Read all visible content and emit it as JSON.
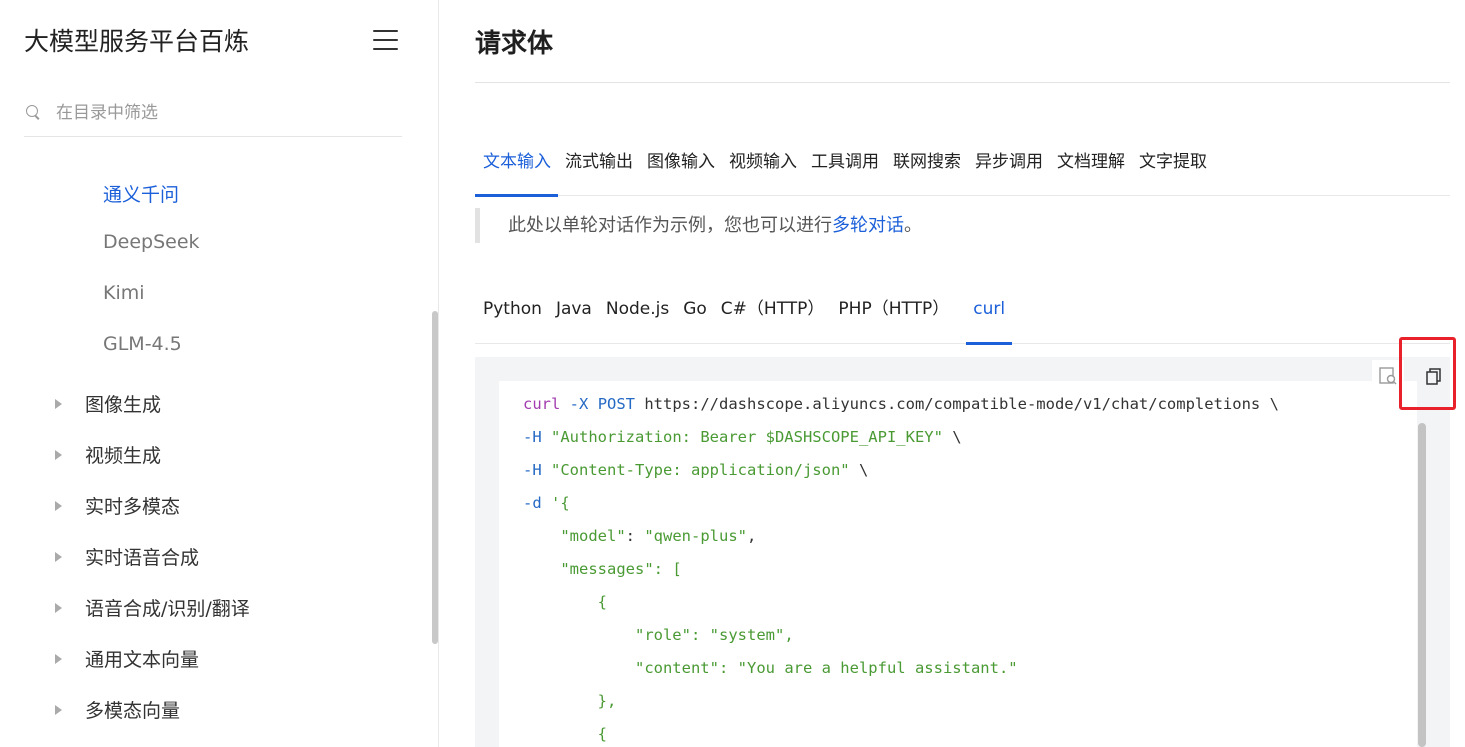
{
  "sidebar": {
    "title": "大模型服务平台百炼",
    "filter_placeholder": "在目录中筛选",
    "sub_items": [
      {
        "label": "通义千问",
        "active": true
      },
      {
        "label": "DeepSeek",
        "active": false
      },
      {
        "label": "Kimi",
        "active": false
      },
      {
        "label": "GLM-4.5",
        "active": false
      }
    ],
    "items": [
      {
        "label": "图像生成"
      },
      {
        "label": "视频生成"
      },
      {
        "label": "实时多模态"
      },
      {
        "label": "实时语音合成"
      },
      {
        "label": "语音合成/识别/翻译"
      },
      {
        "label": "通用文本向量"
      },
      {
        "label": "多模态向量"
      }
    ]
  },
  "main": {
    "title": "请求体",
    "input_tabs": [
      "文本输入",
      "流式输出",
      "图像输入",
      "视频输入",
      "工具调用",
      "联网搜索",
      "异步调用",
      "文档理解",
      "文字提取"
    ],
    "active_input_tab": "文本输入",
    "note": {
      "text": "此处以单轮对话作为示例，您也可以进行",
      "link": "多轮对话",
      "suffix": "。"
    },
    "lang_tabs": [
      "Python",
      "Java",
      "Node.js",
      "Go",
      "C#（HTTP）",
      "PHP（HTTP）",
      "curl"
    ],
    "active_lang_tab": "curl"
  },
  "code": {
    "line1": {
      "cmd": "curl",
      "flag": "-X",
      "method": "POST",
      "url": " https://dashscope.aliyuncs.com/compatible-mode/v1/chat/completions \\"
    },
    "line2": {
      "flag": "-H",
      "value": "\"Authorization: Bearer $DASHSCOPE_API_KEY\"",
      "tail": " \\"
    },
    "line3": {
      "flag": "-H",
      "value": "\"Content-Type: application/json\"",
      "tail": " \\"
    },
    "line4": {
      "flag": "-d",
      "value": "'{"
    },
    "line5": {
      "key": "\"model\"",
      "sep": ": ",
      "value": "\"qwen-plus\"",
      "tail": ","
    },
    "line6": {
      "key": "\"messages\"",
      "sep": ": ["
    },
    "line7": {
      "text": "{"
    },
    "line8": {
      "key": "\"role\"",
      "sep": ": ",
      "value": "\"system\"",
      "tail": ","
    },
    "line9": {
      "key": "\"content\"",
      "sep": ": ",
      "value": "\"You are a helpful assistant.\""
    },
    "line10": {
      "text": "},"
    },
    "line11": {
      "text": "{"
    }
  },
  "colors": {
    "accent": "#1b5fd9",
    "highlight": "#e8212a",
    "code_bg": "#f3f4f6",
    "keyword": "#a23cb0",
    "string": "#4a9a34"
  },
  "icons": [
    "menu-icon",
    "search-icon",
    "caret-right-icon",
    "view-icon",
    "copy-icon"
  ]
}
